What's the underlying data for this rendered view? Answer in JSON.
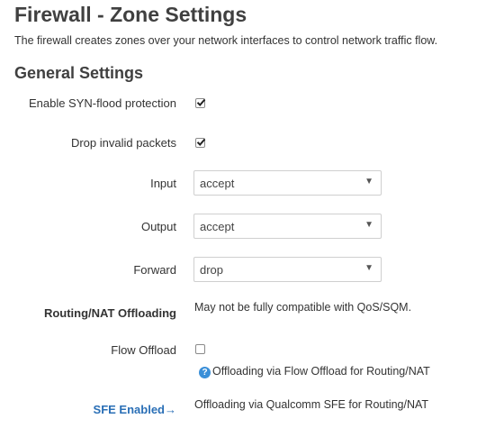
{
  "page": {
    "title": "Firewall - Zone Settings",
    "description": "The firewall creates zones over your network interfaces to control network traffic flow."
  },
  "general": {
    "title": "General Settings",
    "syn_flood": {
      "label": "Enable SYN-flood protection",
      "checked": true
    },
    "drop_invalid": {
      "label": "Drop invalid packets",
      "checked": true
    },
    "input": {
      "label": "Input",
      "value": "accept"
    },
    "output": {
      "label": "Output",
      "value": "accept"
    },
    "forward": {
      "label": "Forward",
      "value": "drop"
    },
    "routing_nat": {
      "label": "Routing/NAT Offloading",
      "note": "May not be fully compatible with QoS/SQM."
    },
    "flow_offload": {
      "label": "Flow Offload",
      "checked": false,
      "help": "Offloading via Flow Offload for Routing/NAT",
      "help_icon": "question-icon"
    },
    "sfe": {
      "label": "SFE Enabled→",
      "note": "Offloading via Qualcomm SFE for Routing/NAT",
      "label_color": "#2a6fb6"
    }
  }
}
